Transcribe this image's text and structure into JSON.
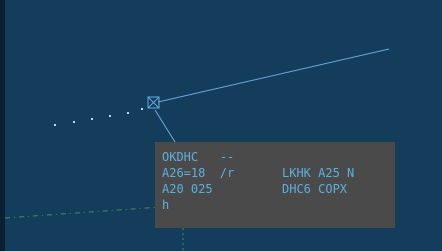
{
  "colors": {
    "background": "#133d5b",
    "left_edge": "#0b1f33",
    "track_line": "#6aa8e0",
    "history_dots": "#b8d8f0",
    "route_line": "#3f8f5f",
    "label_background": "#4a4a4a",
    "label_text": "#5bb0e0"
  },
  "target": {
    "symbol": "square-cross-target",
    "label": {
      "line1": "OKDHC   --",
      "line2_left": "A26=18  /r",
      "line2_right": "LKHK A25 N",
      "line3_left": "A20 025",
      "line3_right": "DHC6 COPX",
      "line4": "h"
    }
  }
}
